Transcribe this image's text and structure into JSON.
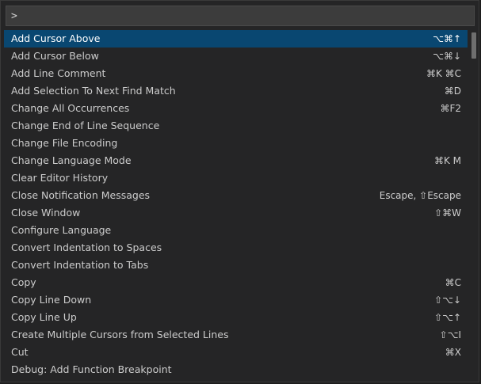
{
  "command_palette": {
    "input_value": ">",
    "items": [
      {
        "label": "Add Cursor Above",
        "keybinding": "⌥⌘↑"
      },
      {
        "label": "Add Cursor Below",
        "keybinding": "⌥⌘↓"
      },
      {
        "label": "Add Line Comment",
        "keybinding": "⌘K ⌘C"
      },
      {
        "label": "Add Selection To Next Find Match",
        "keybinding": "⌘D"
      },
      {
        "label": "Change All Occurrences",
        "keybinding": "⌘F2"
      },
      {
        "label": "Change End of Line Sequence",
        "keybinding": ""
      },
      {
        "label": "Change File Encoding",
        "keybinding": ""
      },
      {
        "label": "Change Language Mode",
        "keybinding": "⌘K M"
      },
      {
        "label": "Clear Editor History",
        "keybinding": ""
      },
      {
        "label": "Close Notification Messages",
        "keybinding": "Escape, ⇧Escape"
      },
      {
        "label": "Close Window",
        "keybinding": "⇧⌘W"
      },
      {
        "label": "Configure Language",
        "keybinding": ""
      },
      {
        "label": "Convert Indentation to Spaces",
        "keybinding": ""
      },
      {
        "label": "Convert Indentation to Tabs",
        "keybinding": ""
      },
      {
        "label": "Copy",
        "keybinding": "⌘C"
      },
      {
        "label": "Copy Line Down",
        "keybinding": "⇧⌥↓"
      },
      {
        "label": "Copy Line Up",
        "keybinding": "⇧⌥↑"
      },
      {
        "label": "Create Multiple Cursors from Selected Lines",
        "keybinding": "⇧⌥I"
      },
      {
        "label": "Cut",
        "keybinding": "⌘X"
      },
      {
        "label": "Debug: Add Function Breakpoint",
        "keybinding": ""
      }
    ],
    "selected_index": 0
  },
  "colors": {
    "background": "#252526",
    "selection": "#094771",
    "text": "#cccccc"
  }
}
